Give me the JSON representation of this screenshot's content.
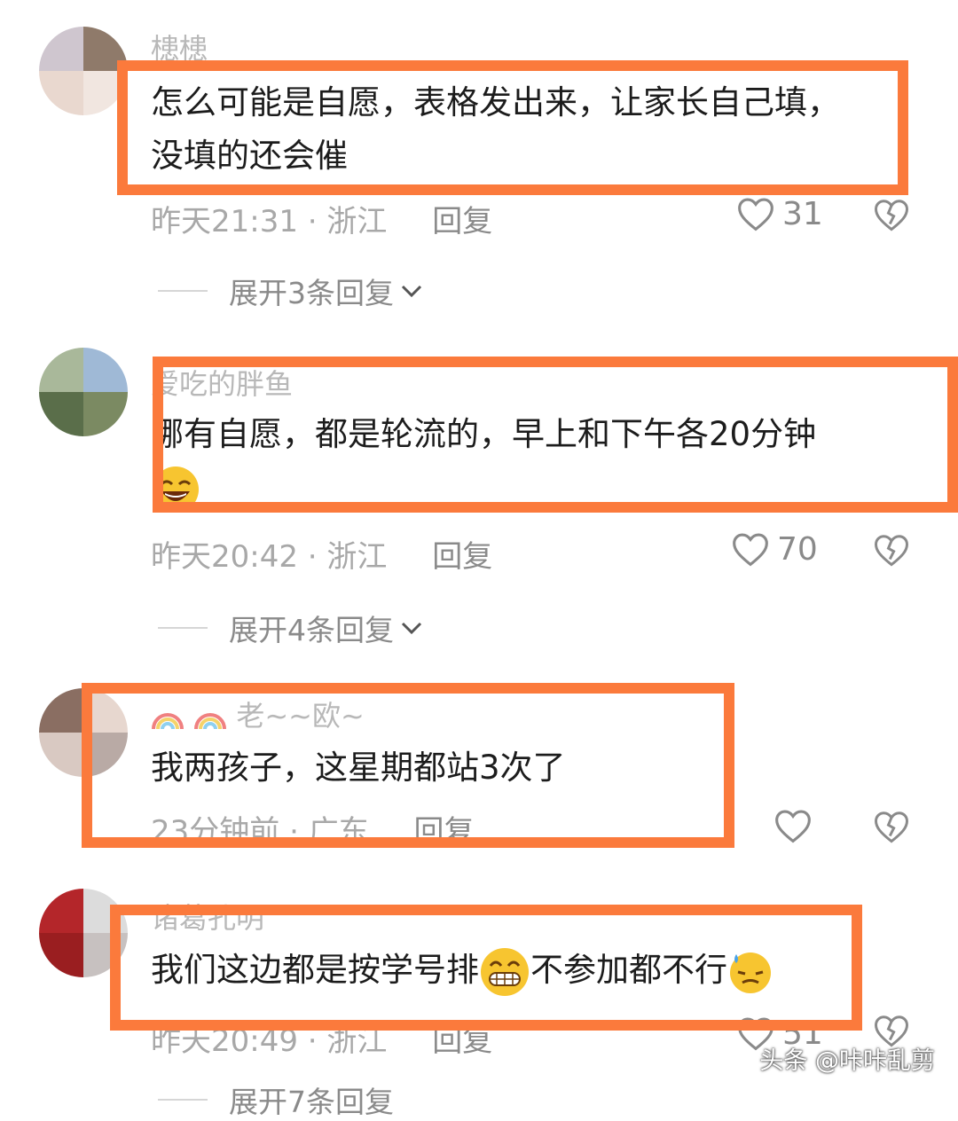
{
  "comments": [
    {
      "username": "槵槵",
      "text_lines": [
        "怎么可能是自愿，表格发出来，让家长自己填，",
        "没填的还会催"
      ],
      "time": "昨天21:31",
      "location": "浙江",
      "reply_label": "回复",
      "likes": "31",
      "expand_label": "展开3条回复"
    },
    {
      "username": "爱吃的胖鱼",
      "text_lines": [
        "哪有自愿，都是轮流的，早上和下午各20分钟"
      ],
      "time": "昨天20:42",
      "location": "浙江",
      "reply_label": "回复",
      "likes": "70",
      "expand_label": "展开4条回复"
    },
    {
      "username": "老~~欧~",
      "text_lines": [
        "我两孩子，这星期都站3次了"
      ],
      "time": "23分钟前",
      "location": "广东",
      "reply_label": "回复",
      "likes": ""
    },
    {
      "username": "诸葛孔明",
      "text_before_emoji": "我们这边都是按学号排",
      "text_middle": "不参加都不行",
      "time": "昨天20:49",
      "location": "浙江",
      "reply_label": "回复",
      "likes": "51",
      "expand_label": "展开7条回复"
    }
  ],
  "separator": "·",
  "watermark": "头条 @咔咔乱剪",
  "colors": {
    "highlight": "#fb7a3c",
    "meta": "#a8a8a8",
    "username": "#b8b8b8"
  },
  "icons": [
    "heart-outline-icon",
    "broken-heart-icon",
    "chevron-down-icon",
    "laughing-emoji",
    "grinning-emoji",
    "sweat-emoji",
    "rainbow-emoji"
  ]
}
